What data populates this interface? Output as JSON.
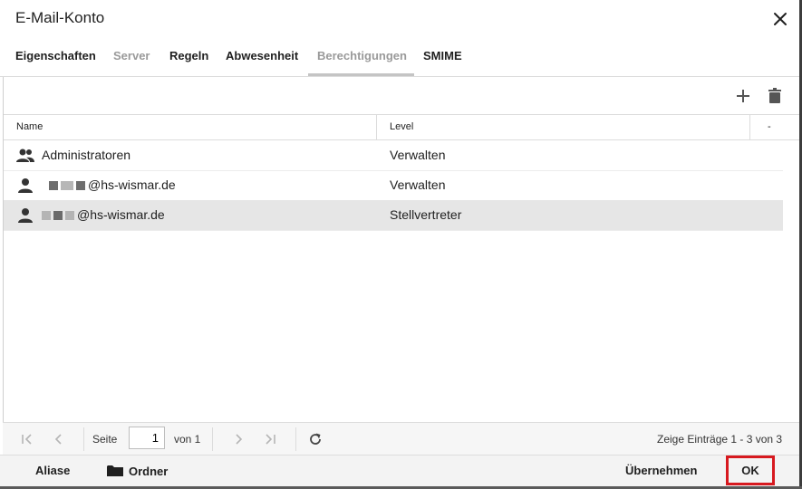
{
  "dialog": {
    "title": "E-Mail-Konto"
  },
  "tabs": [
    {
      "label": "Eigenschaften",
      "state": "normal"
    },
    {
      "label": "Server",
      "state": "muted"
    },
    {
      "label": "Regeln",
      "state": "normal"
    },
    {
      "label": "Abwesenheit",
      "state": "normal"
    },
    {
      "label": "Berechtigungen",
      "state": "active-muted"
    },
    {
      "label": "SMIME",
      "state": "normal"
    }
  ],
  "toolbar": {
    "add_icon": "plus-icon",
    "delete_icon": "trash-icon"
  },
  "grid": {
    "columns": {
      "name": "Name",
      "level": "Level",
      "menu": "-"
    },
    "rows": [
      {
        "icon": "group-icon",
        "name": "Administratoren",
        "level": "Verwalten",
        "selected": false
      },
      {
        "icon": "person-icon",
        "name": "@hs-wismar.de",
        "level": "Verwalten",
        "selected": false
      },
      {
        "icon": "person-icon",
        "name": "@hs-wismar.de",
        "level": "Stellvertreter",
        "selected": true
      }
    ]
  },
  "pager": {
    "page_label": "Seite",
    "page_value": "1",
    "of_label": "von 1",
    "summary": "Zeige Einträge 1 - 3 von 3"
  },
  "footer": {
    "aliase": "Aliase",
    "ordner": "Ordner",
    "apply": "Übernehmen",
    "ok": "OK"
  },
  "colors": {
    "highlight": "#d7191f",
    "selected_row": "#e6e6e6"
  }
}
